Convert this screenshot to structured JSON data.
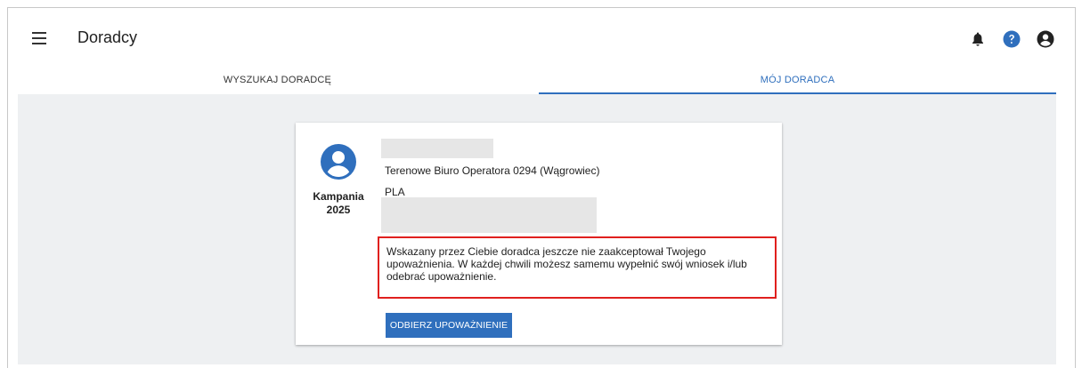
{
  "header": {
    "title": "Doradcy",
    "icons": [
      "menu-icon",
      "bell-icon",
      "help-icon",
      "account-icon"
    ]
  },
  "tabs": [
    {
      "label": "WYSZUKAJ DORADCĘ",
      "active": false
    },
    {
      "label": "MÓJ DORADCA",
      "active": true
    }
  ],
  "advisor_card": {
    "campaign_label": "Kampania",
    "campaign_year": "2025",
    "office": "Terenowe Biuro Operatora 0294 (Wągrowiec)",
    "org": "PLA",
    "notice": "Wskazany przez Ciebie doradca jeszcze nie zaakceptował Twojego upoważnienia. W każdej chwili możesz samemu wypełnić swój wniosek i/lub odebrać upoważnienie.",
    "revoke_button": "ODBIERZ UPOWAŻNIENIE"
  },
  "colors": {
    "accent": "#2f6fbd",
    "notice_border": "#e0201e",
    "background": "#eef0f2",
    "help_icon": "#2f6fbd"
  }
}
